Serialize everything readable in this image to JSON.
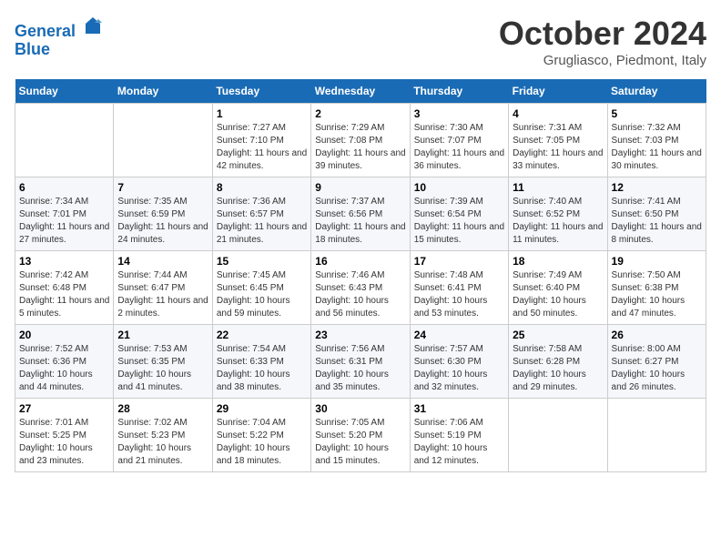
{
  "header": {
    "logo_line1": "General",
    "logo_line2": "Blue",
    "month_title": "October 2024",
    "location": "Grugliasco, Piedmont, Italy"
  },
  "weekdays": [
    "Sunday",
    "Monday",
    "Tuesday",
    "Wednesday",
    "Thursday",
    "Friday",
    "Saturday"
  ],
  "weeks": [
    [
      {
        "day": "",
        "info": ""
      },
      {
        "day": "",
        "info": ""
      },
      {
        "day": "1",
        "info": "Sunrise: 7:27 AM\nSunset: 7:10 PM\nDaylight: 11 hours and 42 minutes."
      },
      {
        "day": "2",
        "info": "Sunrise: 7:29 AM\nSunset: 7:08 PM\nDaylight: 11 hours and 39 minutes."
      },
      {
        "day": "3",
        "info": "Sunrise: 7:30 AM\nSunset: 7:07 PM\nDaylight: 11 hours and 36 minutes."
      },
      {
        "day": "4",
        "info": "Sunrise: 7:31 AM\nSunset: 7:05 PM\nDaylight: 11 hours and 33 minutes."
      },
      {
        "day": "5",
        "info": "Sunrise: 7:32 AM\nSunset: 7:03 PM\nDaylight: 11 hours and 30 minutes."
      }
    ],
    [
      {
        "day": "6",
        "info": "Sunrise: 7:34 AM\nSunset: 7:01 PM\nDaylight: 11 hours and 27 minutes."
      },
      {
        "day": "7",
        "info": "Sunrise: 7:35 AM\nSunset: 6:59 PM\nDaylight: 11 hours and 24 minutes."
      },
      {
        "day": "8",
        "info": "Sunrise: 7:36 AM\nSunset: 6:57 PM\nDaylight: 11 hours and 21 minutes."
      },
      {
        "day": "9",
        "info": "Sunrise: 7:37 AM\nSunset: 6:56 PM\nDaylight: 11 hours and 18 minutes."
      },
      {
        "day": "10",
        "info": "Sunrise: 7:39 AM\nSunset: 6:54 PM\nDaylight: 11 hours and 15 minutes."
      },
      {
        "day": "11",
        "info": "Sunrise: 7:40 AM\nSunset: 6:52 PM\nDaylight: 11 hours and 11 minutes."
      },
      {
        "day": "12",
        "info": "Sunrise: 7:41 AM\nSunset: 6:50 PM\nDaylight: 11 hours and 8 minutes."
      }
    ],
    [
      {
        "day": "13",
        "info": "Sunrise: 7:42 AM\nSunset: 6:48 PM\nDaylight: 11 hours and 5 minutes."
      },
      {
        "day": "14",
        "info": "Sunrise: 7:44 AM\nSunset: 6:47 PM\nDaylight: 11 hours and 2 minutes."
      },
      {
        "day": "15",
        "info": "Sunrise: 7:45 AM\nSunset: 6:45 PM\nDaylight: 10 hours and 59 minutes."
      },
      {
        "day": "16",
        "info": "Sunrise: 7:46 AM\nSunset: 6:43 PM\nDaylight: 10 hours and 56 minutes."
      },
      {
        "day": "17",
        "info": "Sunrise: 7:48 AM\nSunset: 6:41 PM\nDaylight: 10 hours and 53 minutes."
      },
      {
        "day": "18",
        "info": "Sunrise: 7:49 AM\nSunset: 6:40 PM\nDaylight: 10 hours and 50 minutes."
      },
      {
        "day": "19",
        "info": "Sunrise: 7:50 AM\nSunset: 6:38 PM\nDaylight: 10 hours and 47 minutes."
      }
    ],
    [
      {
        "day": "20",
        "info": "Sunrise: 7:52 AM\nSunset: 6:36 PM\nDaylight: 10 hours and 44 minutes."
      },
      {
        "day": "21",
        "info": "Sunrise: 7:53 AM\nSunset: 6:35 PM\nDaylight: 10 hours and 41 minutes."
      },
      {
        "day": "22",
        "info": "Sunrise: 7:54 AM\nSunset: 6:33 PM\nDaylight: 10 hours and 38 minutes."
      },
      {
        "day": "23",
        "info": "Sunrise: 7:56 AM\nSunset: 6:31 PM\nDaylight: 10 hours and 35 minutes."
      },
      {
        "day": "24",
        "info": "Sunrise: 7:57 AM\nSunset: 6:30 PM\nDaylight: 10 hours and 32 minutes."
      },
      {
        "day": "25",
        "info": "Sunrise: 7:58 AM\nSunset: 6:28 PM\nDaylight: 10 hours and 29 minutes."
      },
      {
        "day": "26",
        "info": "Sunrise: 8:00 AM\nSunset: 6:27 PM\nDaylight: 10 hours and 26 minutes."
      }
    ],
    [
      {
        "day": "27",
        "info": "Sunrise: 7:01 AM\nSunset: 5:25 PM\nDaylight: 10 hours and 23 minutes."
      },
      {
        "day": "28",
        "info": "Sunrise: 7:02 AM\nSunset: 5:23 PM\nDaylight: 10 hours and 21 minutes."
      },
      {
        "day": "29",
        "info": "Sunrise: 7:04 AM\nSunset: 5:22 PM\nDaylight: 10 hours and 18 minutes."
      },
      {
        "day": "30",
        "info": "Sunrise: 7:05 AM\nSunset: 5:20 PM\nDaylight: 10 hours and 15 minutes."
      },
      {
        "day": "31",
        "info": "Sunrise: 7:06 AM\nSunset: 5:19 PM\nDaylight: 10 hours and 12 minutes."
      },
      {
        "day": "",
        "info": ""
      },
      {
        "day": "",
        "info": ""
      }
    ]
  ]
}
